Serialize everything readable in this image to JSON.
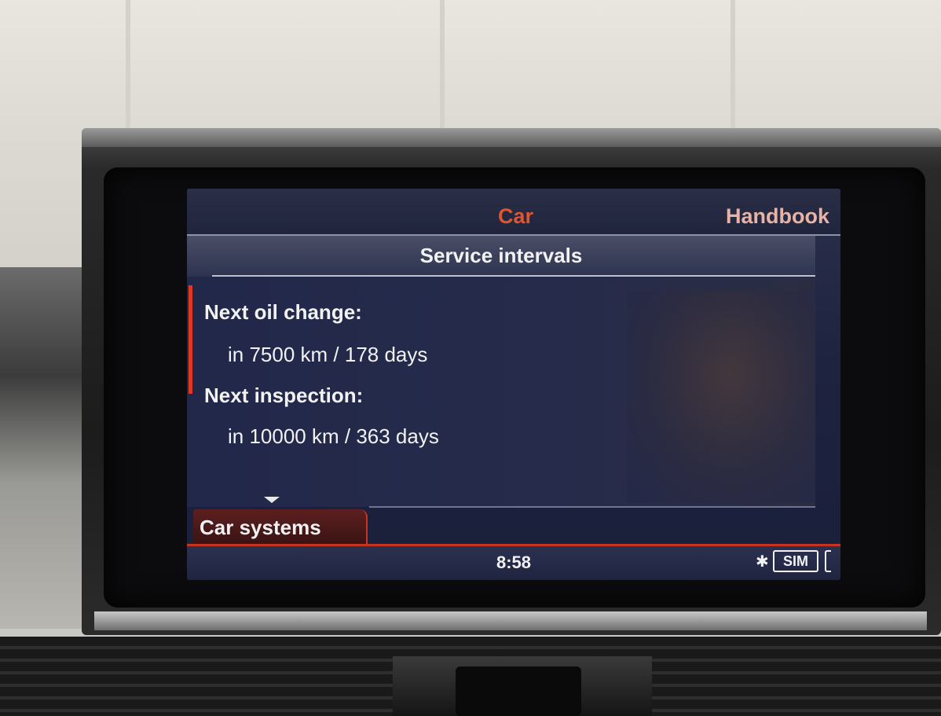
{
  "header": {
    "tabs": [
      {
        "label": "Car",
        "active": true
      },
      {
        "label": "Handbook",
        "active": false
      }
    ]
  },
  "page": {
    "title": "Service intervals"
  },
  "service": {
    "items": [
      {
        "label": "Next oil change:",
        "value": "in 7500 km / 178 days"
      },
      {
        "label": "Next inspection:",
        "value": "in 10000 km / 363 days"
      }
    ]
  },
  "context_tab": {
    "label": "Car systems"
  },
  "status_bar": {
    "time": "8:58",
    "sim_label": "SIM",
    "bluetooth_icon": "bluetooth-icon"
  },
  "colors": {
    "accent_red": "#e0391f",
    "active_tab": "#e0552f",
    "inactive_tab": "#e6b3a6",
    "screen_bg": "#1e2340"
  }
}
